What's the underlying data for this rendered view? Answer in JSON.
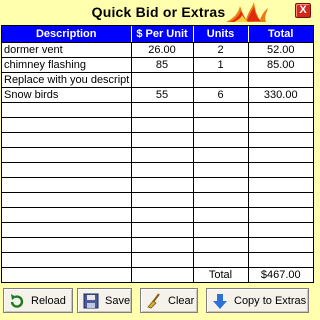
{
  "window": {
    "title": "Quick Bid or Extras",
    "close_label": "X"
  },
  "table": {
    "headers": [
      "Description",
      "$ Per Unit",
      "Units",
      "Total"
    ],
    "rows": [
      [
        "dormer vent",
        "26.00",
        "2",
        "52.00"
      ],
      [
        "chimney flashing",
        "85",
        "1",
        "85.00"
      ],
      [
        "Replace with you descript",
        "",
        "",
        ""
      ],
      [
        "Snow birds",
        "55",
        "6",
        "330.00"
      ],
      [
        "",
        "",
        "",
        ""
      ],
      [
        "",
        "",
        "",
        ""
      ],
      [
        "",
        "",
        "",
        ""
      ],
      [
        "",
        "",
        "",
        ""
      ],
      [
        "",
        "",
        "",
        ""
      ],
      [
        "",
        "",
        "",
        ""
      ],
      [
        "",
        "",
        "",
        ""
      ],
      [
        "",
        "",
        "",
        ""
      ],
      [
        "",
        "",
        "",
        ""
      ],
      [
        "",
        "",
        "",
        ""
      ],
      [
        "",
        "",
        "",
        ""
      ]
    ],
    "total_label": "Total",
    "total_value": "$467.00"
  },
  "buttons": {
    "reload": "Reload",
    "save": "Save",
    "clear": "Clear",
    "copy": "Copy to Extras"
  },
  "colors": {
    "background": "#FFFFAE",
    "header": "#0000FF",
    "close": "#D12A1C"
  }
}
